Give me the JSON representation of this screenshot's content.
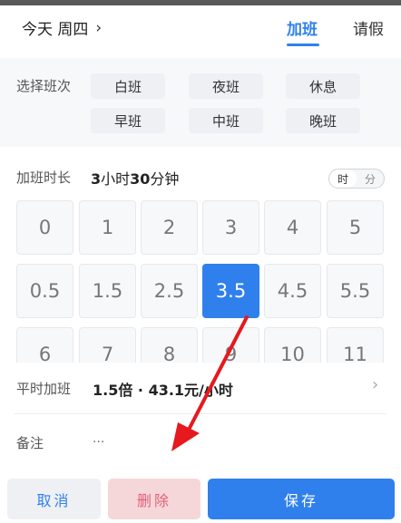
{
  "header": {
    "date": "今天  周四",
    "tabs": {
      "overtime": "加班",
      "leave": "请假"
    }
  },
  "shift": {
    "label": "选择班次",
    "options": [
      "白班",
      "夜班",
      "休息",
      "早班",
      "中班",
      "晚班"
    ]
  },
  "duration": {
    "label": "加班时长",
    "value_num1": "3",
    "value_unit1": "小时",
    "value_num2": "30",
    "value_unit2": "分钟",
    "unit_toggle": {
      "hour": "时",
      "minute": "分",
      "selected": "时"
    }
  },
  "keypad": {
    "keys": [
      "0",
      "1",
      "2",
      "3",
      "4",
      "5",
      "0.5",
      "1.5",
      "2.5",
      "3.5",
      "4.5",
      "5.5",
      "6",
      "7",
      "8",
      "9",
      "10",
      "11"
    ],
    "selected": "3.5"
  },
  "overtime_rate": {
    "label": "平时加班",
    "value": "1.5倍 · 43.1元/小时"
  },
  "note": {
    "label": "备注",
    "placeholder": "···"
  },
  "footer": {
    "cancel": "取消",
    "delete": "删除",
    "save": "保存"
  },
  "colors": {
    "accent": "#2f80ed",
    "delete_bg": "#f6d7d9",
    "arrow": "#e5191e"
  }
}
